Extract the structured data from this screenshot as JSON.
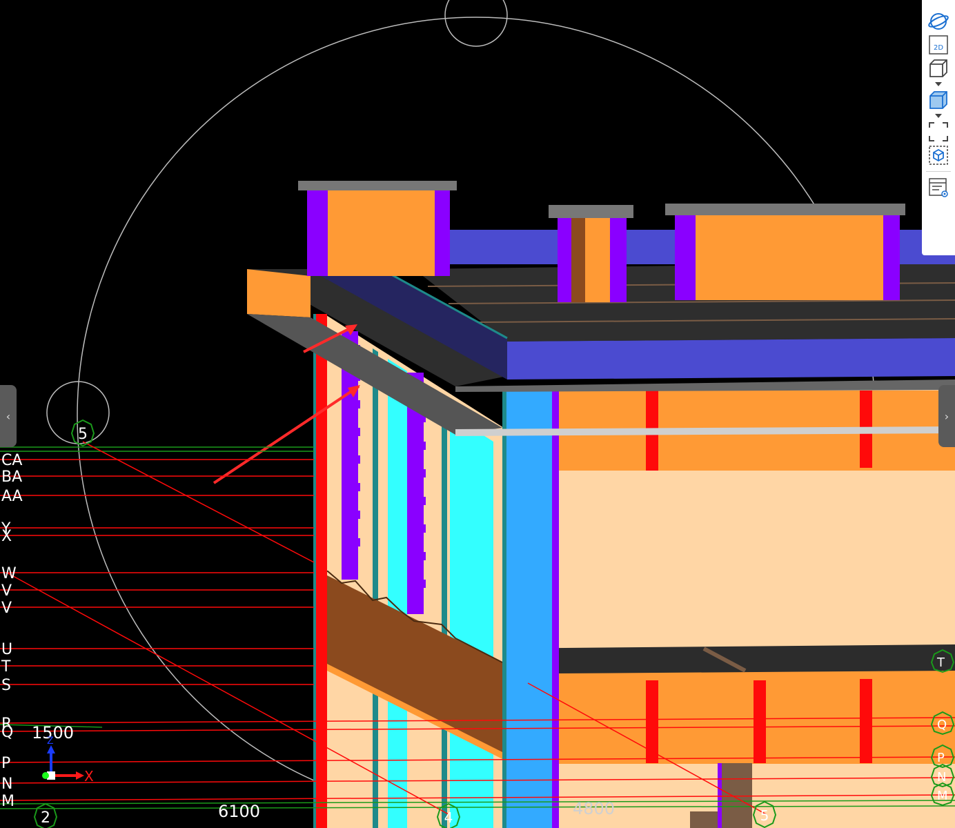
{
  "grid": {
    "row_labels": [
      "CA",
      "BA",
      "AA",
      "Y",
      "X",
      "W",
      "V",
      "V",
      "U",
      "T",
      "S",
      "R",
      "Q",
      "P",
      "N",
      "M"
    ],
    "column_labels": [
      "5",
      "4",
      "2",
      "4",
      "5"
    ],
    "right_labels": [
      "T",
      "Q",
      "P",
      "N",
      "M"
    ],
    "dimensions": [
      "1500",
      "6100",
      "4800"
    ]
  },
  "axes": {
    "x_label": "X",
    "z_label": "Z"
  },
  "toolbar": {
    "items": [
      {
        "name": "orbit",
        "icon": "orbit-icon"
      },
      {
        "name": "2d",
        "icon": "2d-view-icon",
        "label": "2D"
      },
      {
        "name": "3d-box",
        "icon": "cube-outline-icon"
      },
      {
        "name": "3d-shaded",
        "icon": "cube-shaded-icon"
      },
      {
        "name": "fit",
        "icon": "fit-view-icon"
      },
      {
        "name": "isolate",
        "icon": "isolate-cube-icon"
      },
      {
        "name": "properties",
        "icon": "view-properties-icon"
      }
    ]
  },
  "nav": {
    "left_arrow": "‹",
    "right_arrow": "›"
  },
  "colors": {
    "orange": "#ff9a35",
    "peach": "#ffd6a5",
    "purple": "#8a00ff",
    "blue_slab": "#4b4bd0",
    "column_blue": "#33aaff",
    "cyan": "#33ffff",
    "red": "#ff0a0a",
    "grid_green": "#1a9a1a",
    "roof_dark": "#2e2e2e"
  }
}
